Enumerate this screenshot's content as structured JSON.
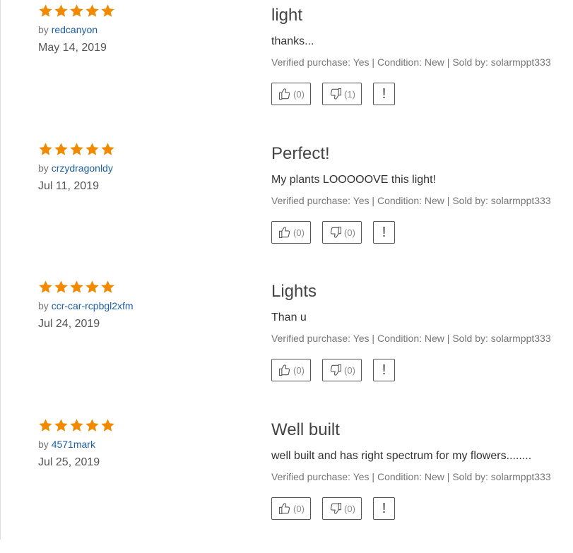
{
  "colors": {
    "star": "#f18a00",
    "reviewer_link": "#1d5ea8",
    "muted_text": "#767676",
    "button_border": "#555555"
  },
  "icons": {
    "star": "star-icon",
    "helpful": "thumbs-up-icon",
    "unhelpful": "thumbs-down-icon",
    "report": "exclamation-icon"
  },
  "reviews": [
    {
      "rating": 5,
      "by_prefix": "by",
      "reviewer": "redcanyon",
      "date": "May 14, 2019",
      "title": "light",
      "body": "thanks...",
      "details": "Verified purchase: Yes | Condition: New | Sold by: solarmppt333",
      "up_count": "(0)",
      "down_count": "(1)",
      "report_label": "!"
    },
    {
      "rating": 5,
      "by_prefix": "by",
      "reviewer": "crzydragonldy",
      "date": "Jul 11, 2019",
      "title": "Perfect!",
      "body": "My plants LOOOOOVE this light!",
      "details": "Verified purchase: Yes | Condition: New | Sold by: solarmppt333",
      "up_count": "(0)",
      "down_count": "(0)",
      "report_label": "!"
    },
    {
      "rating": 5,
      "by_prefix": "by",
      "reviewer": "ccr-car-rcpbgl2xfm",
      "date": "Jul 24, 2019",
      "title": "Lights",
      "body": "Than u",
      "details": "Verified purchase: Yes | Condition: New | Sold by: solarmppt333",
      "up_count": "(0)",
      "down_count": "(0)",
      "report_label": "!"
    },
    {
      "rating": 5,
      "by_prefix": "by",
      "reviewer": "4571mark",
      "date": "Jul 25, 2019",
      "title": "Well built",
      "body": "well built and has right spectrum for my flowers........",
      "details": "Verified purchase: Yes | Condition: New | Sold by: solarmppt333",
      "up_count": "(0)",
      "down_count": "(0)",
      "report_label": "!"
    }
  ]
}
